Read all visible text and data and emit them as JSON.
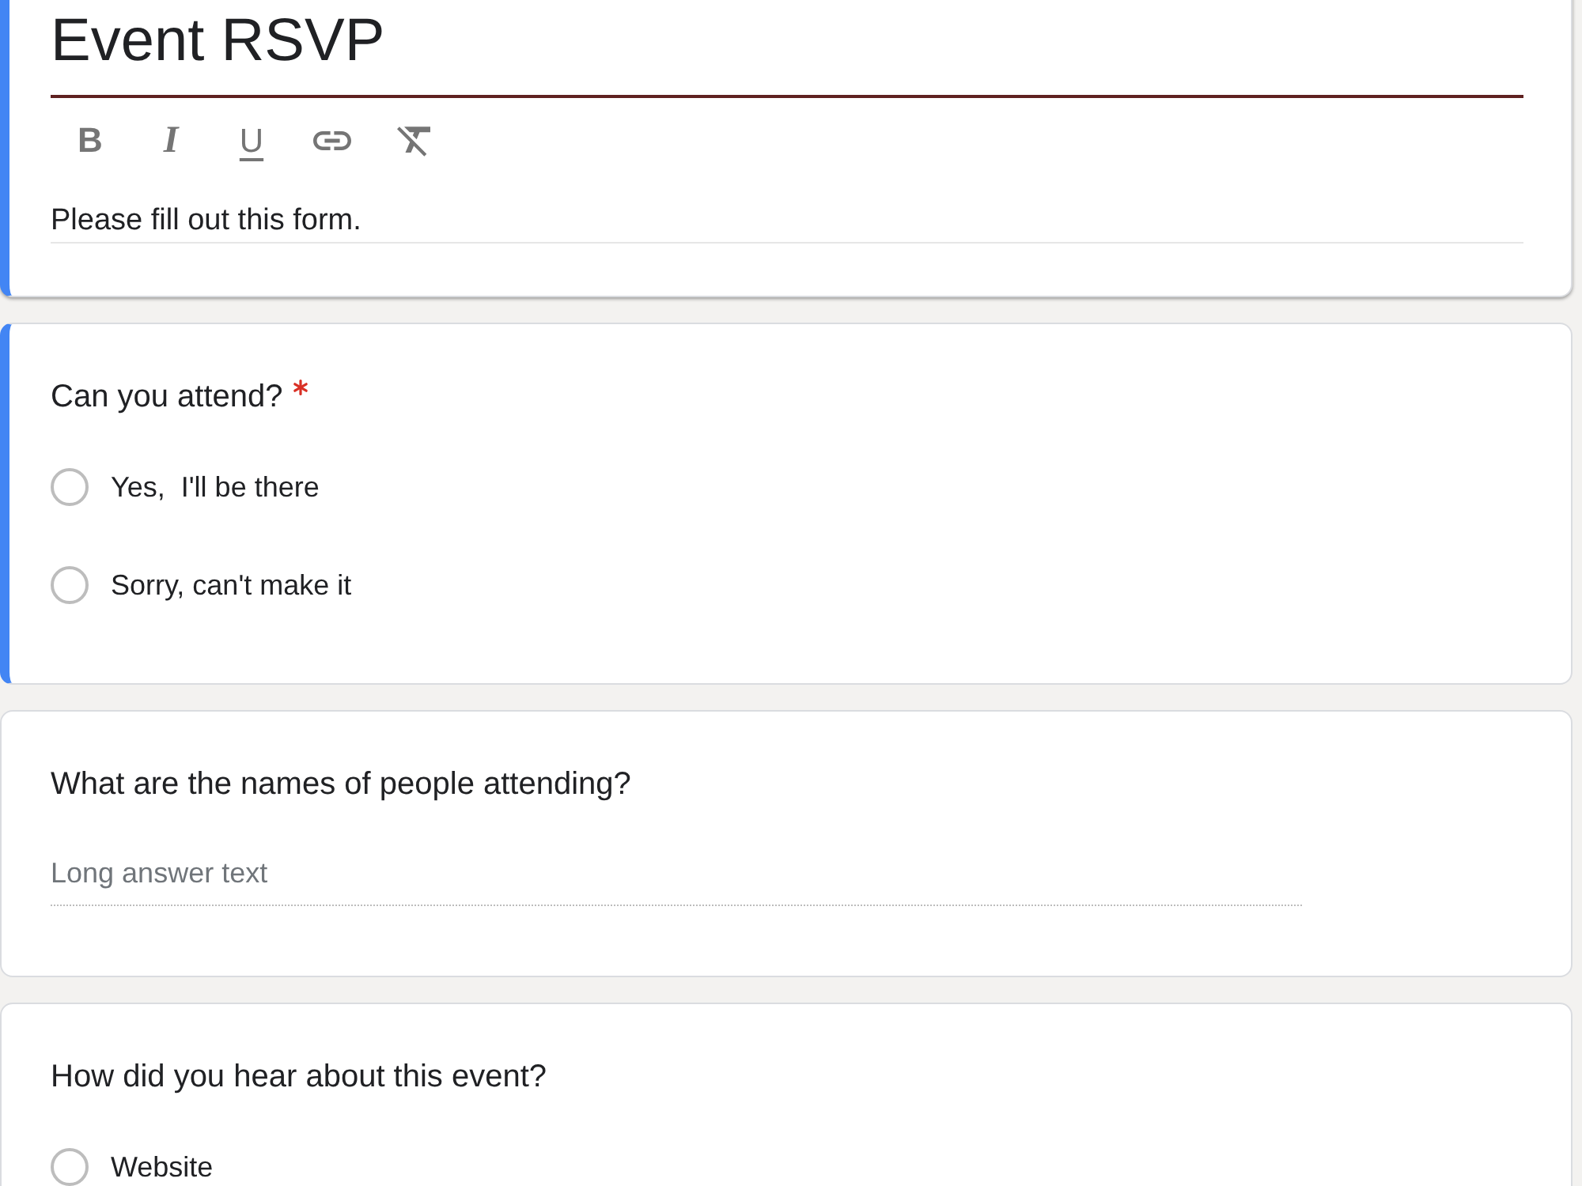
{
  "form_header": {
    "title": "Event RSVP",
    "focused": true,
    "toolbar": [
      {
        "kind": "bold",
        "glyph": "B"
      },
      {
        "kind": "italic",
        "glyph": "I"
      },
      {
        "kind": "underline",
        "glyph": "U"
      },
      {
        "kind": "link"
      },
      {
        "kind": "clear_format"
      }
    ],
    "description": "Please fill out this form."
  },
  "questions": [
    {
      "kind": "multiple_choice",
      "title": "Can you attend?",
      "required": true,
      "focused": true,
      "options": [
        {
          "label": "Yes,  I'll be there",
          "selected": false
        },
        {
          "label": "Sorry, can't make it",
          "selected": false
        }
      ]
    },
    {
      "kind": "paragraph",
      "title": "What are the names of people attending?",
      "required": false,
      "focused": false,
      "placeholder": "Long answer text"
    },
    {
      "kind": "multiple_choice",
      "title": "How did you hear about this event?",
      "required": false,
      "focused": false,
      "options": [
        {
          "label": "Website",
          "selected": false
        }
      ]
    }
  ]
}
